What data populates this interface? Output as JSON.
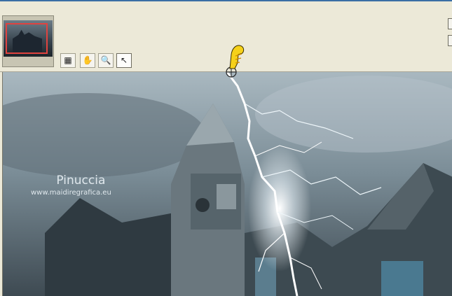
{
  "toolbar": {
    "tools": [
      {
        "name": "layers-tool",
        "glyph": "▦"
      },
      {
        "name": "pan-hand-tool",
        "glyph": "✋"
      },
      {
        "name": "zoom-tool",
        "glyph": "🔍"
      },
      {
        "name": "arrow-select-tool",
        "glyph": "↖"
      }
    ]
  },
  "canvas": {
    "watermark_name": "Pinuccia",
    "watermark_url": "www.maidiregrafica.eu"
  },
  "colors": {
    "window_bg": "#ece9d8",
    "thumb_frame": "#e0433f",
    "pointer_yellow": "#f6d11a"
  }
}
